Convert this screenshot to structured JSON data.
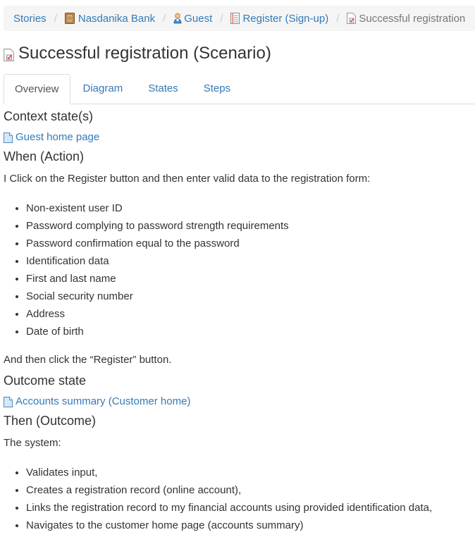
{
  "breadcrumb": [
    {
      "label": "Stories",
      "icon": "none"
    },
    {
      "label": "Nasdanika Bank",
      "icon": "ledger-icon"
    },
    {
      "label": "Guest",
      "icon": "user-icon"
    },
    {
      "label": "Register (Sign-up)",
      "icon": "list-document-icon"
    },
    {
      "label": "Successful registration",
      "icon": "checked-document-icon",
      "active": true
    }
  ],
  "page": {
    "title": "Successful registration (Scenario)"
  },
  "tabs": [
    {
      "label": "Overview",
      "active": true
    },
    {
      "label": "Diagram"
    },
    {
      "label": "States"
    },
    {
      "label": "Steps"
    }
  ],
  "sections": {
    "context_heading": "Context state(s)",
    "context_link": "Guest home page",
    "when_heading": "When (Action)",
    "when_intro": "I Click on the Register button and then enter valid data to the registration form:",
    "when_items": [
      "Non-existent user ID",
      "Password complying to password strength requirements",
      "Password confirmation equal to the password",
      "Identification data",
      "First and last name",
      "Social security number",
      "Address",
      "Date of birth"
    ],
    "when_outro": "And then click the “Register” button.",
    "outcome_heading": "Outcome state",
    "outcome_link": "Accounts summary (Customer home)",
    "then_heading": "Then (Outcome)",
    "then_intro": "The system:",
    "then_items": [
      "Validates input,",
      "Creates a registration record (online account),",
      "Links the registration record to my financial accounts using provided identification data,",
      "Navigates to the customer home page (accounts summary)"
    ]
  },
  "colors": {
    "link": "#337ab7",
    "breadcrumb_bg": "#f5f5f5",
    "active_crumb": "#777777"
  }
}
